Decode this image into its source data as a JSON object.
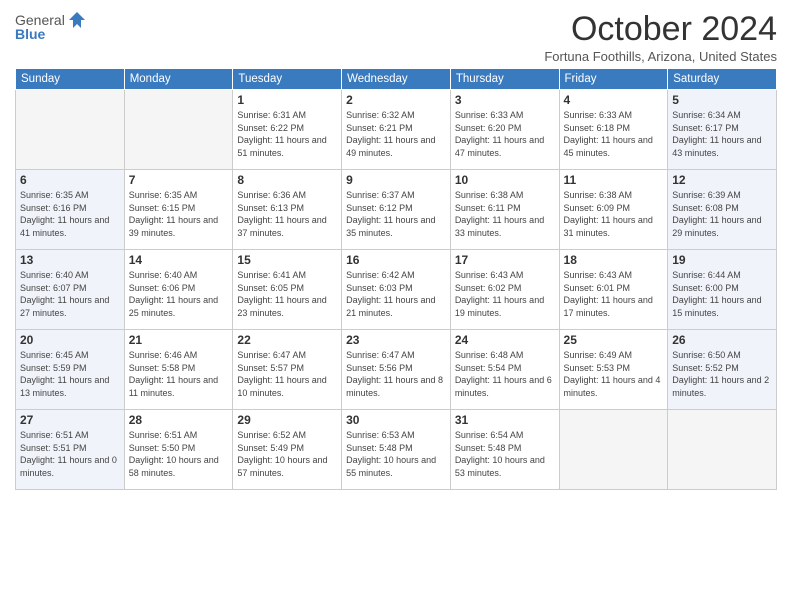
{
  "header": {
    "logo_general": "General",
    "logo_blue": "Blue",
    "title": "October 2024",
    "subtitle": "Fortuna Foothills, Arizona, United States"
  },
  "weekdays": [
    "Sunday",
    "Monday",
    "Tuesday",
    "Wednesday",
    "Thursday",
    "Friday",
    "Saturday"
  ],
  "weeks": [
    [
      {
        "day": "",
        "info": ""
      },
      {
        "day": "",
        "info": ""
      },
      {
        "day": "1",
        "info": "Sunrise: 6:31 AM\nSunset: 6:22 PM\nDaylight: 11 hours and 51 minutes."
      },
      {
        "day": "2",
        "info": "Sunrise: 6:32 AM\nSunset: 6:21 PM\nDaylight: 11 hours and 49 minutes."
      },
      {
        "day": "3",
        "info": "Sunrise: 6:33 AM\nSunset: 6:20 PM\nDaylight: 11 hours and 47 minutes."
      },
      {
        "day": "4",
        "info": "Sunrise: 6:33 AM\nSunset: 6:18 PM\nDaylight: 11 hours and 45 minutes."
      },
      {
        "day": "5",
        "info": "Sunrise: 6:34 AM\nSunset: 6:17 PM\nDaylight: 11 hours and 43 minutes."
      }
    ],
    [
      {
        "day": "6",
        "info": "Sunrise: 6:35 AM\nSunset: 6:16 PM\nDaylight: 11 hours and 41 minutes."
      },
      {
        "day": "7",
        "info": "Sunrise: 6:35 AM\nSunset: 6:15 PM\nDaylight: 11 hours and 39 minutes."
      },
      {
        "day": "8",
        "info": "Sunrise: 6:36 AM\nSunset: 6:13 PM\nDaylight: 11 hours and 37 minutes."
      },
      {
        "day": "9",
        "info": "Sunrise: 6:37 AM\nSunset: 6:12 PM\nDaylight: 11 hours and 35 minutes."
      },
      {
        "day": "10",
        "info": "Sunrise: 6:38 AM\nSunset: 6:11 PM\nDaylight: 11 hours and 33 minutes."
      },
      {
        "day": "11",
        "info": "Sunrise: 6:38 AM\nSunset: 6:09 PM\nDaylight: 11 hours and 31 minutes."
      },
      {
        "day": "12",
        "info": "Sunrise: 6:39 AM\nSunset: 6:08 PM\nDaylight: 11 hours and 29 minutes."
      }
    ],
    [
      {
        "day": "13",
        "info": "Sunrise: 6:40 AM\nSunset: 6:07 PM\nDaylight: 11 hours and 27 minutes."
      },
      {
        "day": "14",
        "info": "Sunrise: 6:40 AM\nSunset: 6:06 PM\nDaylight: 11 hours and 25 minutes."
      },
      {
        "day": "15",
        "info": "Sunrise: 6:41 AM\nSunset: 6:05 PM\nDaylight: 11 hours and 23 minutes."
      },
      {
        "day": "16",
        "info": "Sunrise: 6:42 AM\nSunset: 6:03 PM\nDaylight: 11 hours and 21 minutes."
      },
      {
        "day": "17",
        "info": "Sunrise: 6:43 AM\nSunset: 6:02 PM\nDaylight: 11 hours and 19 minutes."
      },
      {
        "day": "18",
        "info": "Sunrise: 6:43 AM\nSunset: 6:01 PM\nDaylight: 11 hours and 17 minutes."
      },
      {
        "day": "19",
        "info": "Sunrise: 6:44 AM\nSunset: 6:00 PM\nDaylight: 11 hours and 15 minutes."
      }
    ],
    [
      {
        "day": "20",
        "info": "Sunrise: 6:45 AM\nSunset: 5:59 PM\nDaylight: 11 hours and 13 minutes."
      },
      {
        "day": "21",
        "info": "Sunrise: 6:46 AM\nSunset: 5:58 PM\nDaylight: 11 hours and 11 minutes."
      },
      {
        "day": "22",
        "info": "Sunrise: 6:47 AM\nSunset: 5:57 PM\nDaylight: 11 hours and 10 minutes."
      },
      {
        "day": "23",
        "info": "Sunrise: 6:47 AM\nSunset: 5:56 PM\nDaylight: 11 hours and 8 minutes."
      },
      {
        "day": "24",
        "info": "Sunrise: 6:48 AM\nSunset: 5:54 PM\nDaylight: 11 hours and 6 minutes."
      },
      {
        "day": "25",
        "info": "Sunrise: 6:49 AM\nSunset: 5:53 PM\nDaylight: 11 hours and 4 minutes."
      },
      {
        "day": "26",
        "info": "Sunrise: 6:50 AM\nSunset: 5:52 PM\nDaylight: 11 hours and 2 minutes."
      }
    ],
    [
      {
        "day": "27",
        "info": "Sunrise: 6:51 AM\nSunset: 5:51 PM\nDaylight: 11 hours and 0 minutes."
      },
      {
        "day": "28",
        "info": "Sunrise: 6:51 AM\nSunset: 5:50 PM\nDaylight: 10 hours and 58 minutes."
      },
      {
        "day": "29",
        "info": "Sunrise: 6:52 AM\nSunset: 5:49 PM\nDaylight: 10 hours and 57 minutes."
      },
      {
        "day": "30",
        "info": "Sunrise: 6:53 AM\nSunset: 5:48 PM\nDaylight: 10 hours and 55 minutes."
      },
      {
        "day": "31",
        "info": "Sunrise: 6:54 AM\nSunset: 5:48 PM\nDaylight: 10 hours and 53 minutes."
      },
      {
        "day": "",
        "info": ""
      },
      {
        "day": "",
        "info": ""
      }
    ]
  ]
}
